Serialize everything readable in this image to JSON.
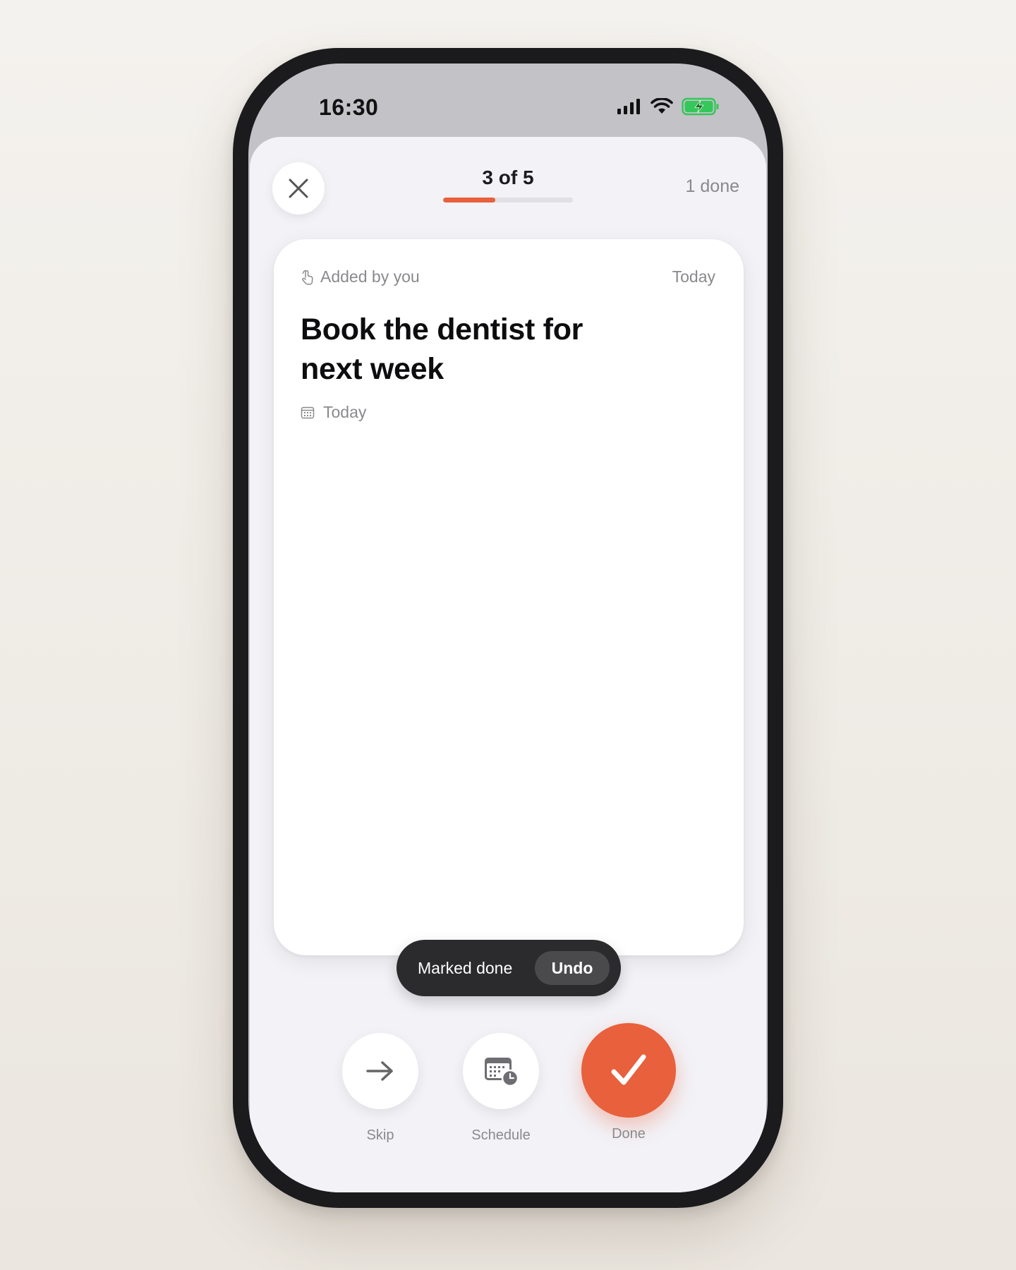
{
  "status_bar": {
    "time": "16:30",
    "icons": [
      "signal-icon",
      "wifi-icon",
      "battery-charging-icon"
    ]
  },
  "header": {
    "progress_text": "3 of 5",
    "progress_fraction": 0.4,
    "done_count": "1 done"
  },
  "card": {
    "source": "Added by you",
    "date": "Today",
    "title": "Book the dentist for next week",
    "due": "Today"
  },
  "toast": {
    "message": "Marked done",
    "undo_label": "Undo"
  },
  "actions": {
    "skip_label": "Skip",
    "schedule_label": "Schedule",
    "done_label": "Done"
  },
  "colors": {
    "accent": "#e8603c",
    "battery": "#34c759",
    "toast_bg": "#2b2b2d"
  }
}
